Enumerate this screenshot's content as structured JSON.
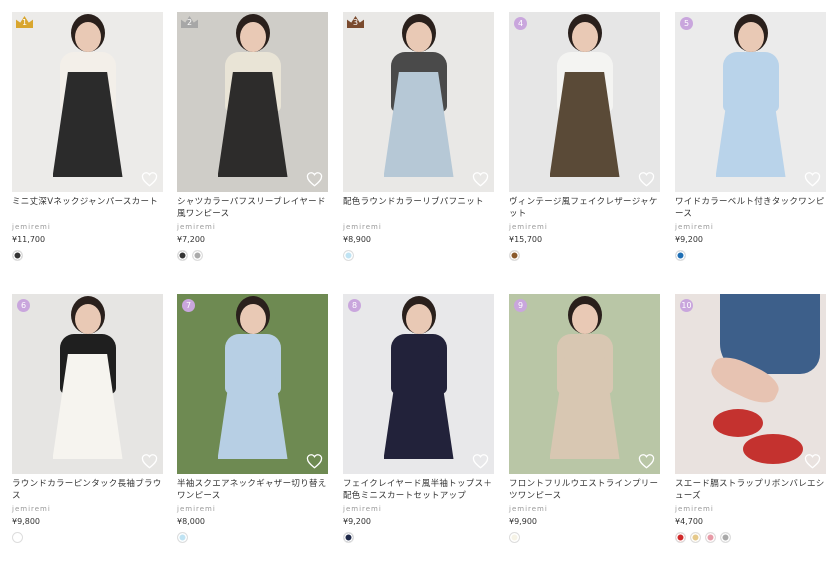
{
  "products": [
    {
      "rank": "1",
      "rank_style": "crown",
      "rank_color": "#d9a62e",
      "title": "ミニ丈深Vネックジャンパースカート",
      "brand": "jemiremi",
      "price": "¥11,700",
      "colors": [
        "#333333"
      ],
      "bg": "#ecebe9",
      "figure": "#2b2b2b",
      "accent": "#f3efe9",
      "heart_icon": "heart-outline-icon"
    },
    {
      "rank": "2",
      "rank_style": "crown",
      "rank_color": "#a7a7a7",
      "title": "シャツカラーパフスリーブレイヤード風ワンピース",
      "brand": "jemiremi",
      "price": "¥7,200",
      "colors": [
        "#333333",
        "#aaaaaa"
      ],
      "bg": "#cfcdc8",
      "figure": "#2d2c2b",
      "accent": "#e9e4d6",
      "heart_icon": "heart-outline-icon"
    },
    {
      "rank": "3",
      "rank_style": "crown",
      "rank_color": "#7a4a2e",
      "title": "配色ラウンドカラーリブパフニット",
      "brand": "jemiremi",
      "price": "¥8,900",
      "colors": [
        "#bfe3f3"
      ],
      "bg": "#e9e8e6",
      "figure": "#b6c8d6",
      "accent": "#4a4a4a",
      "heart_icon": "heart-outline-icon"
    },
    {
      "rank": "4",
      "rank_style": "circle",
      "rank_color": "#c9a6dd",
      "title": "ヴィンテージ風フェイクレザージャケット",
      "brand": "jemiremi",
      "price": "¥15,700",
      "colors": [
        "#8b5a2b"
      ],
      "bg": "#e6e6e6",
      "figure": "#5a4a37",
      "accent": "#f4f4f2",
      "heart_icon": "heart-outline-icon"
    },
    {
      "rank": "5",
      "rank_style": "circle",
      "rank_color": "#c9a6dd",
      "title": "ワイドカラーベルト付きタックワンピース",
      "brand": "jemiremi",
      "price": "¥9,200",
      "colors": [
        "#1f6fb5"
      ],
      "bg": "#ebebeb",
      "figure": "#b9d3ea",
      "accent": "#b9d3ea",
      "heart_icon": "heart-outline-icon"
    },
    {
      "rank": "6",
      "rank_style": "circle",
      "rank_color": "#c9a6dd",
      "title": "ラウンドカラーピンタック長袖ブラウス",
      "brand": "jemiremi",
      "price": "¥9,800",
      "colors": [
        "#ffffff"
      ],
      "bg": "#e6e5e3",
      "figure": "#f6f4ef",
      "accent": "#1f1f1f",
      "heart_icon": "heart-outline-icon"
    },
    {
      "rank": "7",
      "rank_style": "circle",
      "rank_color": "#c9a6dd",
      "title": "半袖スクエアネックギャザー切り替えワンピース",
      "brand": "jemiremi",
      "price": "¥8,000",
      "colors": [
        "#bfe3f3"
      ],
      "bg": "#6e8a52",
      "figure": "#b7cfe4",
      "accent": "#b7cfe4",
      "heart_icon": "heart-outline-icon"
    },
    {
      "rank": "8",
      "rank_style": "circle",
      "rank_color": "#c9a6dd",
      "title": "フェイクレイヤード風半袖トップス＋配色ミニスカートセットアップ",
      "brand": "jemiremi",
      "price": "¥9,200",
      "colors": [
        "#1f2a4a"
      ],
      "bg": "#e8e8ea",
      "figure": "#22223a",
      "accent": "#22223a",
      "heart_icon": "heart-outline-icon"
    },
    {
      "rank": "9",
      "rank_style": "circle",
      "rank_color": "#c9a6dd",
      "title": "フロントフリルウエストラインプリーツワンピース",
      "brand": "jemiremi",
      "price": "¥9,900",
      "colors": [
        "#f6f3e6"
      ],
      "bg": "#b9c6a6",
      "figure": "#d8c7b2",
      "accent": "#d8c7b2",
      "heart_icon": "heart-outline-icon"
    },
    {
      "rank": "10",
      "rank_style": "circle",
      "rank_color": "#c9a6dd",
      "title": "スエード膈ストラップリボンバレエシューズ",
      "brand": "jemiremi",
      "price": "¥4,700",
      "colors": [
        "#d12a2a",
        "#e6c98a",
        "#e79aa6",
        "#a9a9a9"
      ],
      "bg": "#e9e2df",
      "figure": "#3d5f8a",
      "accent": "#c4322f",
      "heart_icon": "heart-outline-icon"
    }
  ]
}
